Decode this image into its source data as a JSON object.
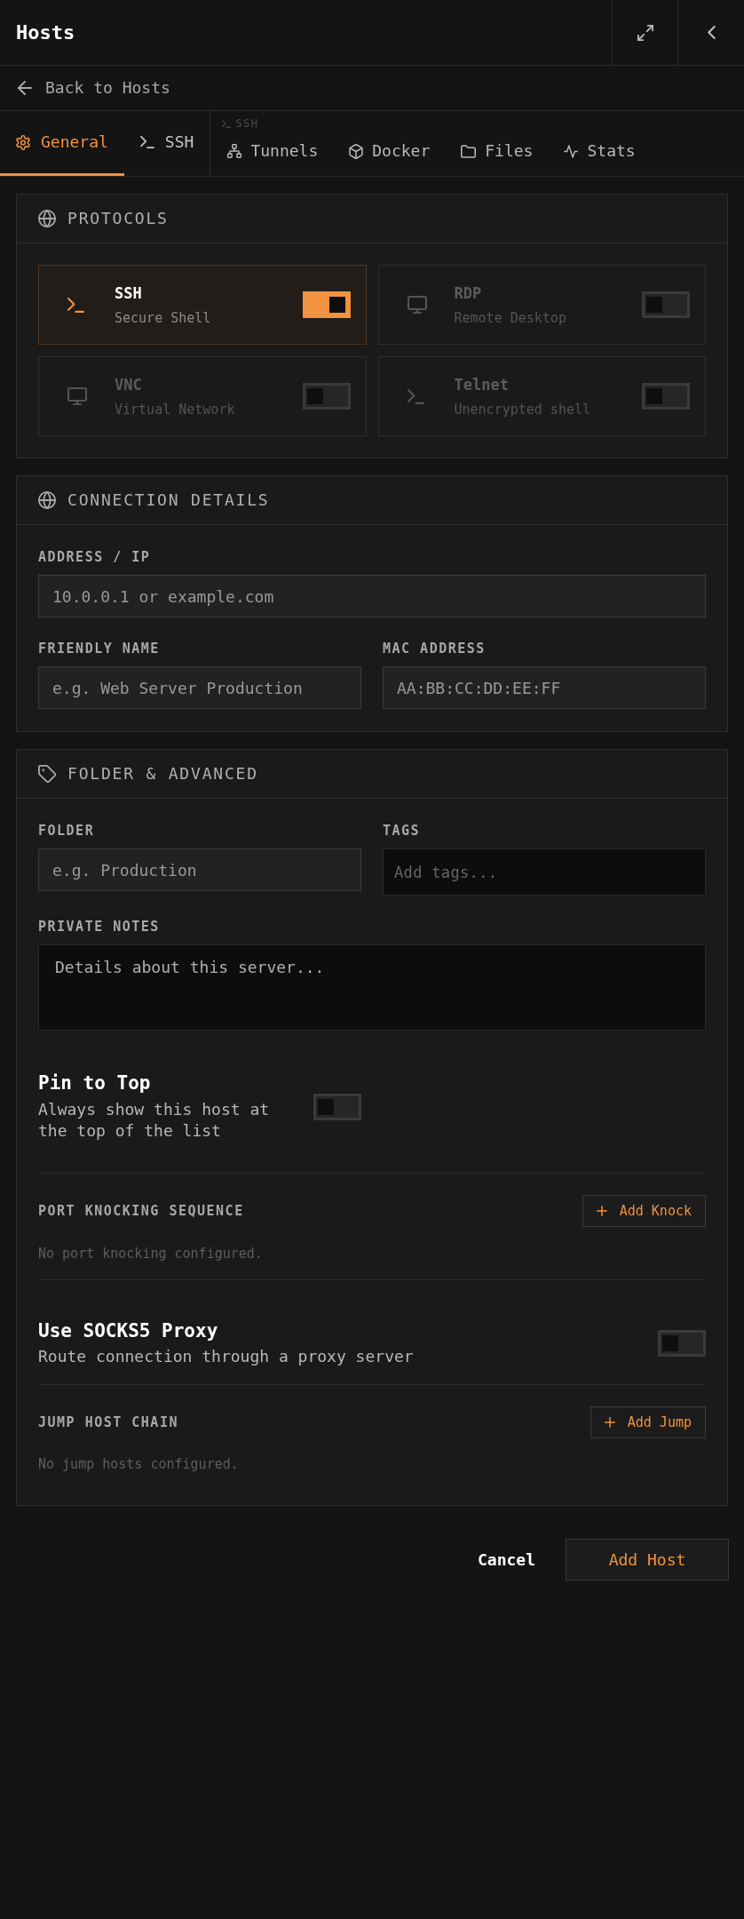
{
  "header": {
    "title": "Hosts"
  },
  "back_link": {
    "label": "Back to Hosts"
  },
  "tabs": [
    {
      "label": "General",
      "selected": true
    },
    {
      "label": "SSH",
      "selected": false
    }
  ],
  "ssh_tab_group": {
    "caption": "SSH",
    "tabs": [
      {
        "label": "Tunnels",
        "selected": false
      },
      {
        "label": "Docker",
        "selected": false
      },
      {
        "label": "Files",
        "selected": false
      },
      {
        "label": "Stats",
        "selected": false
      }
    ]
  },
  "protocols": {
    "title": "PROTOCOLS",
    "items": [
      {
        "name": "SSH",
        "description": "Secure Shell",
        "on": true
      },
      {
        "name": "RDP",
        "description": "Remote Desktop",
        "on": false
      },
      {
        "name": "VNC",
        "description": "Virtual Network",
        "on": false
      },
      {
        "name": "Telnet",
        "description": "Unencrypted shell",
        "on": false
      }
    ]
  },
  "connection_details": {
    "title": "CONNECTION DETAILS",
    "rows": [
      [
        {
          "kind": "text",
          "label": "ADDRESS / IP",
          "placeholder": "10.0.0.1 or example.com"
        }
      ],
      [
        {
          "kind": "text",
          "label": "FRIENDLY NAME",
          "placeholder": "e.g. Web Server Production"
        },
        {
          "kind": "text",
          "label": "MAC ADDRESS",
          "placeholder": "AA:BB:CC:DD:EE:FF"
        }
      ]
    ]
  },
  "folder_advanced": {
    "title": "FOLDER & ADVANCED",
    "rows": [
      [
        {
          "kind": "text",
          "label": "FOLDER",
          "placeholder": "e.g. Production"
        },
        {
          "kind": "tags",
          "label": "TAGS",
          "placeholder": "Add tags..."
        }
      ],
      [
        {
          "kind": "textarea",
          "label": "PRIVATE NOTES",
          "placeholder": "Details about this server..."
        }
      ]
    ],
    "pin_to_top": {
      "title": "Pin to Top",
      "description": "Always show this host at the top of the list",
      "on": false
    },
    "port_knocking": {
      "label": "PORT KNOCKING SEQUENCE",
      "button": "Add Knock",
      "empty_text": "No port knocking configured."
    },
    "socks5_proxy": {
      "title": "Use SOCKS5 Proxy",
      "description": "Route connection through a proxy server",
      "on": false
    },
    "jump_host_chain": {
      "label": "JUMP HOST CHAIN",
      "button": "Add Jump",
      "empty_text": "No jump hosts configured."
    }
  },
  "footer": {
    "cancel": "Cancel",
    "submit": "Add Host"
  }
}
